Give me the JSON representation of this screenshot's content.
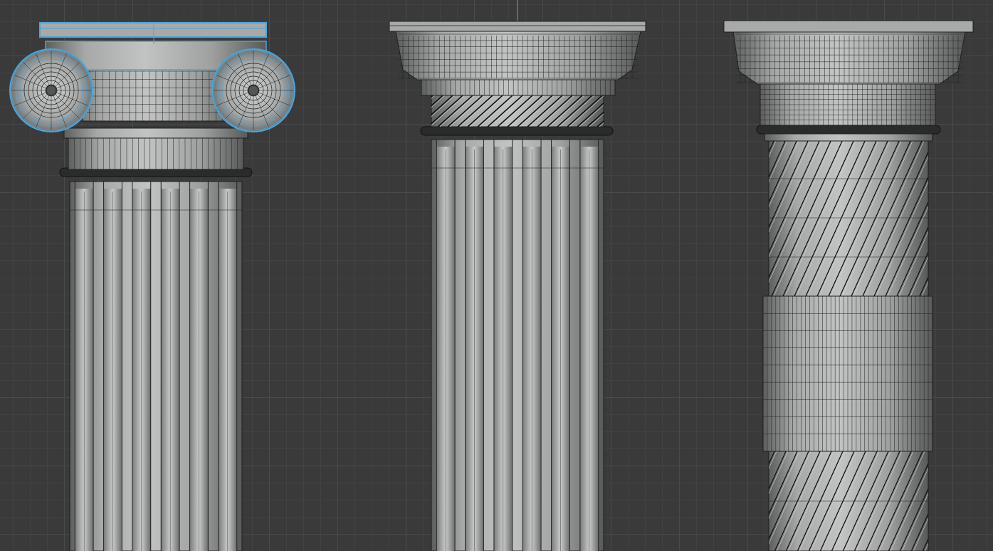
{
  "viewport": {
    "mode": "orthographic-front",
    "background_color": "#3a3a3a",
    "grid_major_color": "#4a4a4a",
    "grid_minor_color": "#424242"
  },
  "colors": {
    "mesh_fill": "#8f9190",
    "mesh_light": "#b8bab9",
    "wire": "#1e1f1f",
    "selection_outline": "#4fa3d8",
    "ring_dark": "#2a2b2b"
  },
  "objects": [
    {
      "id": "ionic-column",
      "selected": true,
      "capital": "ionic-volutes",
      "shaft": "fluted"
    },
    {
      "id": "doric-column",
      "selected": false,
      "capital": "echinus",
      "shaft": "fluted",
      "neck": "twisted"
    },
    {
      "id": "twisted-column",
      "selected": false,
      "capital": "echinus",
      "shaft": "spiral",
      "band": "plain"
    }
  ]
}
